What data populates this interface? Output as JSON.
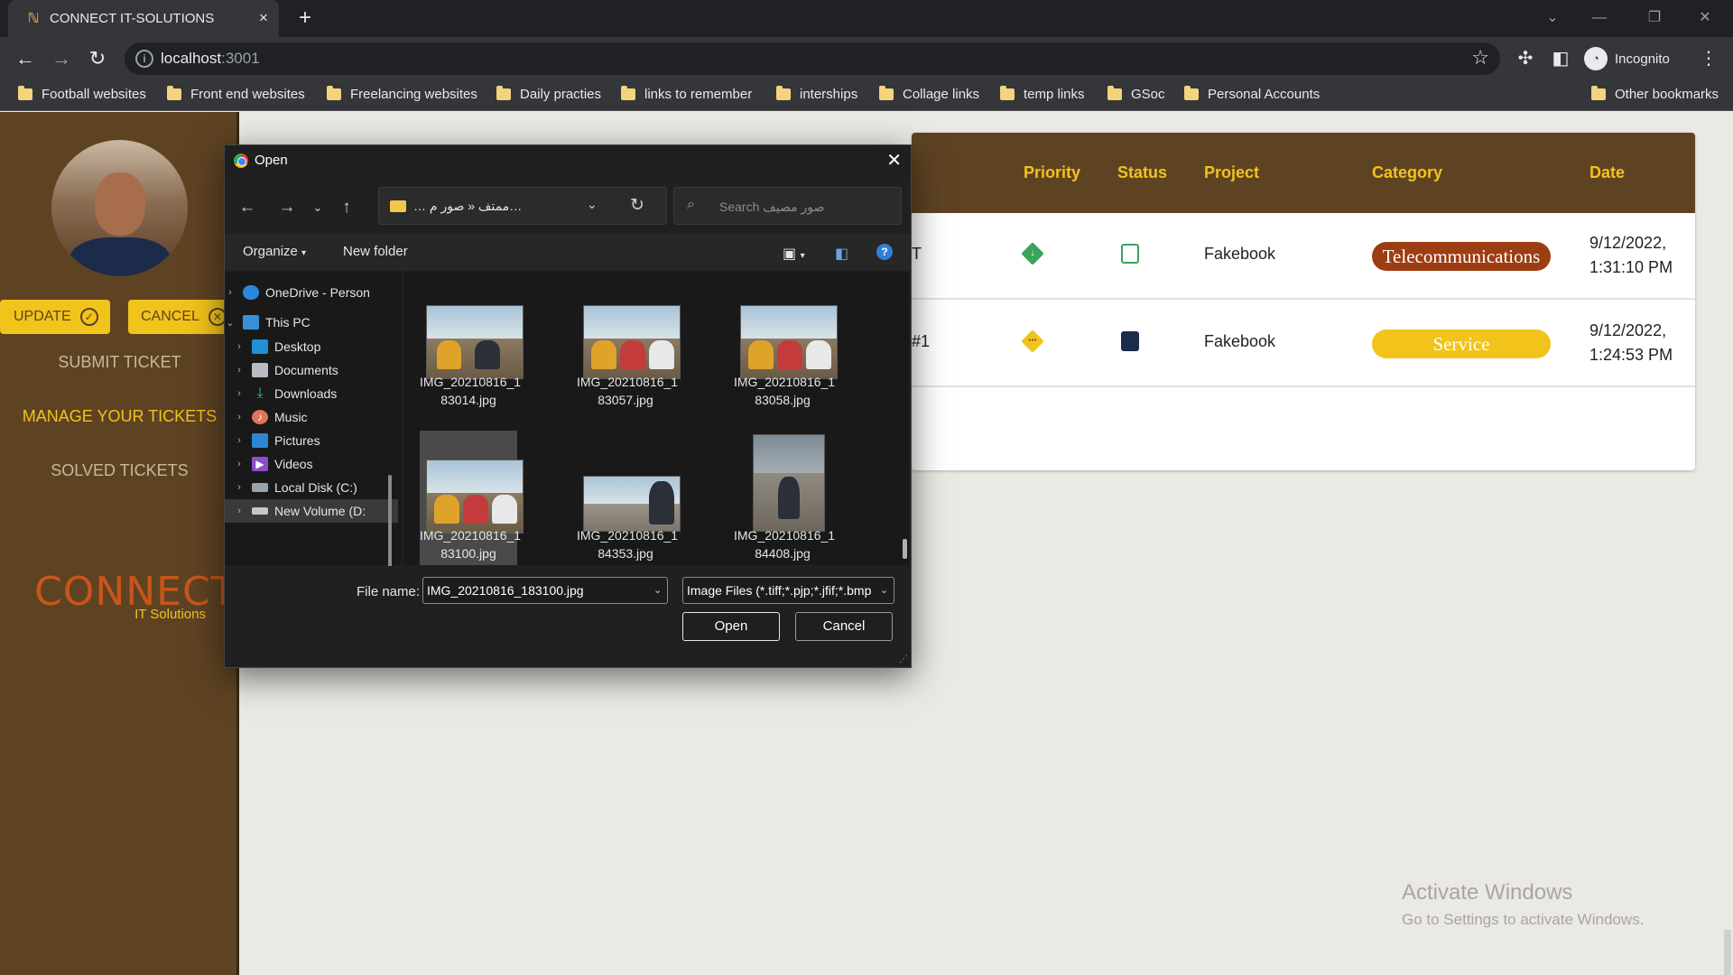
{
  "browser": {
    "tab_title": "CONNECT IT-SOLUTIONS",
    "tab_close": "×",
    "new_tab": "+",
    "url_host": "localhost",
    "url_port": ":3001",
    "profile_label": "Incognito",
    "bookmarks": [
      "Football websites",
      "Front end websites",
      "Freelancing websites",
      "Daily practies",
      "links to remember",
      "interships",
      "Collage links",
      "temp links",
      "GSoc",
      "Personal Accounts"
    ],
    "other_bookmarks": "Other bookmarks"
  },
  "sidebar": {
    "update_label": "UPDATE",
    "cancel_label": "CANCEL",
    "nav": [
      "SUBMIT TICKET",
      "MANAGE YOUR TICKETS",
      "SOLVED TICKETS"
    ],
    "active_nav_index": 1,
    "logo_main": "CONNECT",
    "logo_sub": "IT Solutions"
  },
  "table": {
    "headers": {
      "priority": "Priority",
      "status": "Status",
      "project": "Project",
      "category": "Category",
      "date": "Date"
    },
    "rows": [
      {
        "id_fragment": "T",
        "priority_color": "#3aa35a",
        "status_icon": "clipboard-clock-icon",
        "project": "Fakebook",
        "category": "Telecommunications",
        "category_color": "#9c3d13",
        "date_line1": "9/12/2022,",
        "date_line2": "1:31:10 PM"
      },
      {
        "id_fragment": "#1",
        "priority_color": "#f2c31b",
        "status_icon": "assignment-ind-icon",
        "project": "Fakebook",
        "category": "Service",
        "category_color": "#f2c31b",
        "date_line1": "9/12/2022,",
        "date_line2": "1:24:53 PM"
      }
    ]
  },
  "dialog": {
    "title": "Open",
    "path_text": "… ممتف  «  صور م…",
    "search_placeholder": "Search صور مصيف",
    "organize_label": "Organize",
    "new_folder_label": "New folder",
    "tree": [
      {
        "label": "OneDrive - Person",
        "icon": "onedrive-icon"
      },
      {
        "label": "This PC",
        "icon": "this-pc-icon"
      },
      {
        "label": "Desktop",
        "icon": "desktop-icon"
      },
      {
        "label": "Documents",
        "icon": "documents-icon"
      },
      {
        "label": "Downloads",
        "icon": "downloads-icon"
      },
      {
        "label": "Music",
        "icon": "music-icon"
      },
      {
        "label": "Pictures",
        "icon": "pictures-icon"
      },
      {
        "label": "Videos",
        "icon": "videos-icon"
      },
      {
        "label": "Local Disk (C:)",
        "icon": "local-disk-icon"
      },
      {
        "label": "New Volume (D:",
        "icon": "new-volume-icon"
      }
    ],
    "files": [
      {
        "line1": "IMG_20210816_1",
        "line2": "83014.jpg"
      },
      {
        "line1": "IMG_20210816_1",
        "line2": "83057.jpg"
      },
      {
        "line1": "IMG_20210816_1",
        "line2": "83058.jpg"
      },
      {
        "line1": "IMG_20210816_1",
        "line2": "83100.jpg"
      },
      {
        "line1": "IMG_20210816_1",
        "line2": "84353.jpg"
      },
      {
        "line1": "IMG_20210816_1",
        "line2": "84408.jpg"
      }
    ],
    "selected_file_index": 3,
    "file_name_label": "File name:",
    "file_name_value": "IMG_20210816_183100.jpg",
    "file_type": "Image Files (*.tiff;*.pjp;*.jfif;*.bmp",
    "open_label": "Open",
    "cancel_label": "Cancel"
  },
  "watermark": {
    "line1": "Activate Windows",
    "line2": "Go to Settings to activate Windows."
  },
  "colors": {
    "brown": "#5e4323",
    "yellow": "#f2c31b",
    "rust": "#9c3d13",
    "page_bg": "#ebe9e3"
  }
}
